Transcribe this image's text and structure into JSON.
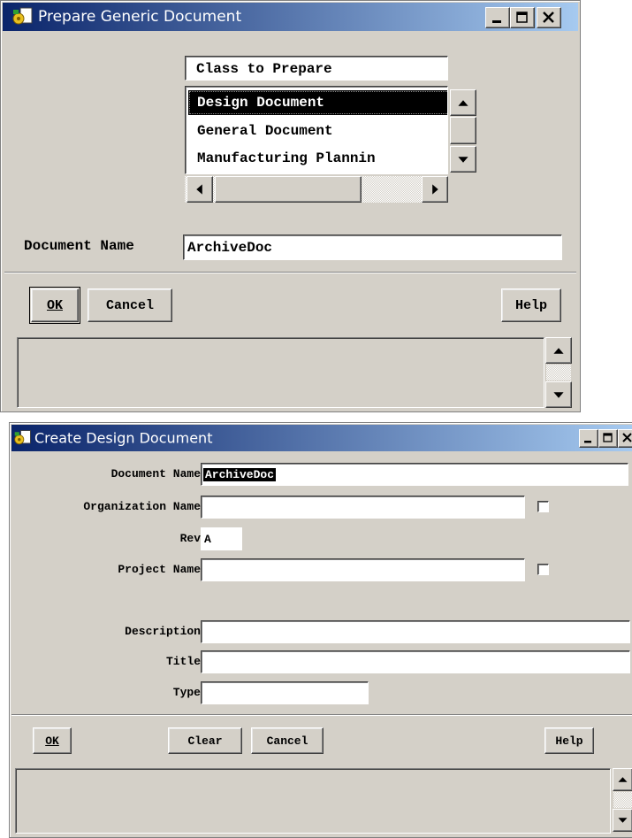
{
  "prepare_window": {
    "title": "Prepare Generic Document",
    "class_header": "Class to Prepare",
    "class_items": [
      "Design Document",
      "General Document",
      "Manufacturing Plannin"
    ],
    "selected_index": 0,
    "document_name_label": "Document Name",
    "document_name_value": "ArchiveDoc",
    "buttons": {
      "ok": "OK",
      "cancel": "Cancel",
      "help": "Help"
    }
  },
  "create_window": {
    "title": "Create Design Document",
    "fields": {
      "document_name": {
        "label": "Document Name",
        "value": "ArchiveDoc"
      },
      "organization_name": {
        "label": "Organization Name",
        "value": ""
      },
      "rev": {
        "label": "Rev",
        "value": "A"
      },
      "project_name": {
        "label": "Project Name",
        "value": ""
      },
      "description": {
        "label": "Description",
        "value": ""
      },
      "title": {
        "label": "Title",
        "value": ""
      },
      "type": {
        "label": "Type",
        "value": ""
      }
    },
    "buttons": {
      "ok": "OK",
      "clear": "Clear",
      "cancel": "Cancel",
      "help": "Help"
    }
  },
  "colors": {
    "titlebar_start": "#0a246a",
    "titlebar_end": "#a6caf0",
    "window_face": "#d4d0c8",
    "selection": "#000000"
  },
  "icons": [
    "app-icon",
    "minimize-icon",
    "maximize-icon",
    "close-icon",
    "arrow-up-icon",
    "arrow-down-icon",
    "arrow-left-icon",
    "arrow-right-icon"
  ]
}
